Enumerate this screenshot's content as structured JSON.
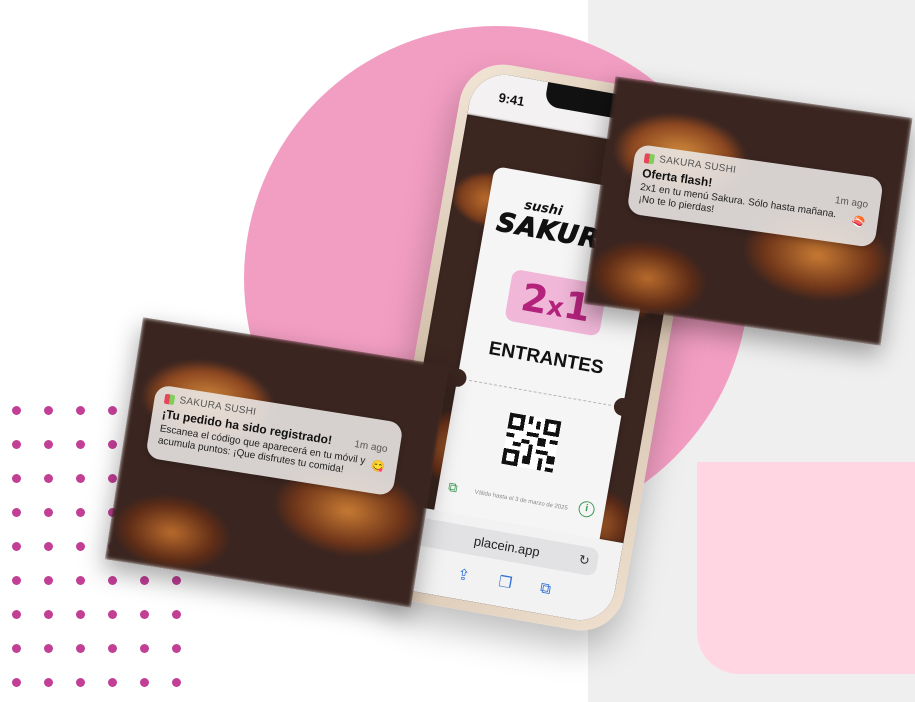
{
  "colors": {
    "pink_circle": "#f29ec2",
    "pink_blob": "#ffd6e2",
    "dot_color": "#c23f96",
    "panel_gray": "#efefef",
    "promo_pink": "#f0b7d8",
    "promo_text": "#b3237c",
    "accent_green": "#3d9a55",
    "ios_blue": "#2f6fd6"
  },
  "phone": {
    "time": "9:41",
    "url": "placein.app",
    "icons": {
      "reload": "reload-icon",
      "back": "back-icon",
      "share": "share-icon",
      "bookmarks": "book-icon",
      "tabs": "tabs-icon"
    }
  },
  "coupon": {
    "brand_script": "sushi",
    "brand_main": "SAKURA",
    "promo_num1": "2",
    "promo_x": "x",
    "promo_num2": "1",
    "category": "ENTRANTES",
    "validity": "Válido hasta el 3 de marzo de 2025"
  },
  "notifications": [
    {
      "app": "SAKURA SUSHI",
      "title": "¡Tu pedido ha sido registrado!",
      "time": "1m ago",
      "body": "Escanea el código que aparecerá en tu móvil y acumula puntos: ¡Que disfrutes tu comida!",
      "emoji": "😋"
    },
    {
      "app": "SAKURA SUSHI",
      "title": "Oferta flash!",
      "time": "1m ago",
      "body": "2x1 en tu menú Sakura. Sólo hasta mañana. ¡No te lo pierdas!",
      "emoji": "🍣"
    }
  ]
}
